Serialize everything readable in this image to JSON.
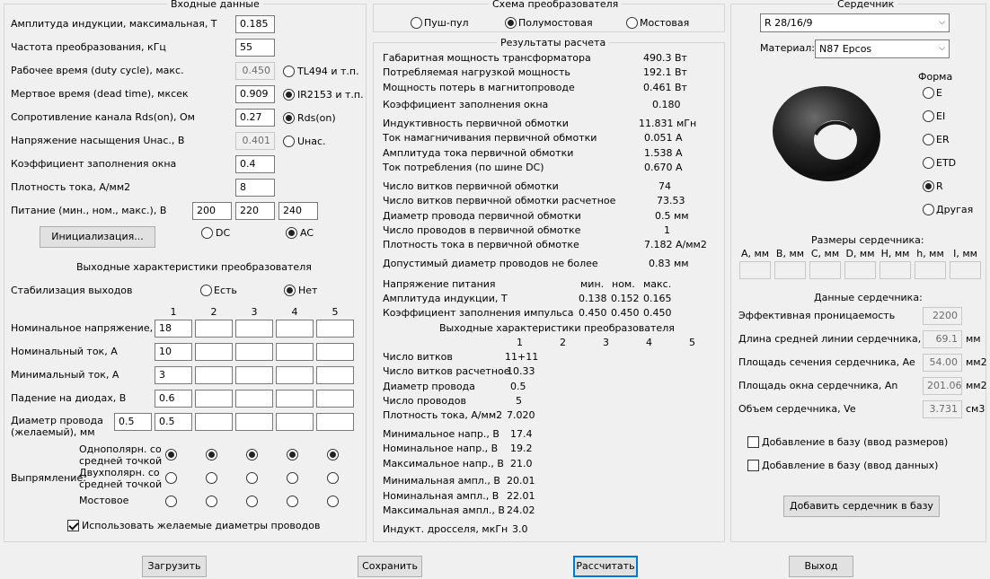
{
  "input": {
    "title": "Входные данные",
    "rows": [
      {
        "label": "Амплитуда индукции, максимальная, Т",
        "value": "0.185"
      },
      {
        "label": "Частота преобразования, кГц",
        "value": "55"
      },
      {
        "label": "Рабочее время (duty cycle), макс.",
        "value": "0.450"
      },
      {
        "label": "Мертвое время (dead time), мксек",
        "value": "0.909"
      },
      {
        "label": "Сопротивление канала Rds(on), Ом",
        "value": "0.27"
      },
      {
        "label": "Напряжение насыщения Uнас., В",
        "value": "0.401"
      },
      {
        "label": "Коэффициент заполнения окна",
        "value": "0.4"
      },
      {
        "label": "Плотность тока, А/мм2",
        "value": "8"
      },
      {
        "label": "Питание (мин., ном., макс.), В",
        "value": ""
      }
    ],
    "supply": [
      "200",
      "220",
      "240"
    ],
    "side_radios": [
      "TL494 и т.п.",
      "IR2153 и т.п.",
      "Rds(on)",
      "Uнас."
    ],
    "init_button": "Инициализация...",
    "dc": "DC",
    "ac": "AC"
  },
  "out": {
    "title": "Выходные характеристики преобразователя",
    "stab_label": "Стабилизация выходов",
    "stab_yes": "Есть",
    "stab_no": "Нет",
    "cols": [
      "1",
      "2",
      "3",
      "4",
      "5"
    ],
    "rows": [
      {
        "label": "Номинальное напряжение, В",
        "v1": "18"
      },
      {
        "label": "Номинальный ток, А",
        "v1": "10"
      },
      {
        "label": "Минимальный ток, А",
        "v1": "3"
      },
      {
        "label": "Падение на диодах, В",
        "v1": "0.6"
      }
    ],
    "wire_label1": "Диаметр провода",
    "wire_label2": "(желаемый), мм",
    "wire_value": "0.5",
    "wire_v1": "0.5",
    "rect_label": "Выпрямление:",
    "rect_opt1a": "Однополярн. со",
    "rect_opt1b": "средней точкой",
    "rect_opt2a": "Двухполярн. со",
    "rect_opt2b": "средней точкой",
    "rect_opt3": "Мостовое",
    "use_wire": "Использовать желаемые диаметры проводов"
  },
  "scheme": {
    "title": "Схема преобразователя",
    "opts": [
      "Пуш-пул",
      "Полумостовая",
      "Мостовая"
    ]
  },
  "results": {
    "title": "Результаты расчета",
    "rows": [
      {
        "label": "Габаритная мощность трансформатора",
        "value": "490.3 Вт"
      },
      {
        "label": "Потребляемая нагрузкой мощность",
        "value": "192.1 Вт"
      },
      {
        "label": "Мощность потерь в магнитопроводе",
        "value": "0.461 Вт"
      },
      {
        "label": "Коэффициент заполнения окна",
        "value": "0.180"
      },
      {
        "label": "Индуктивность первичной обмотки",
        "value": "11.831 мГн"
      },
      {
        "label": "Ток намагничивания первичной обмотки",
        "value": "0.051 А"
      },
      {
        "label": "Амплитуда тока первичной обмотки",
        "value": "1.538 А"
      },
      {
        "label": "Ток потребления (по шине DC)",
        "value": "0.670 А"
      },
      {
        "label": "Число витков первичной обмотки",
        "value": "74"
      },
      {
        "label": "Число витков первичной обмотки расчетное",
        "value": "73.53"
      },
      {
        "label": "Диаметр провода первичной обмотки",
        "value": "0.5 мм"
      },
      {
        "label": "Число проводов в первичной обмотке",
        "value": "1"
      },
      {
        "label": "Плотность тока в первичной обмотке",
        "value": "7.182 А/мм2"
      },
      {
        "label": "Допустимый диаметр проводов не более",
        "value": "0.83 мм"
      }
    ],
    "supply_hdr": "Напряжение питания",
    "min": "мин.",
    "nom": "ном.",
    "max": "макс.",
    "ind_label": "Амплитуда индукции, Т",
    "ind_vals": [
      "0.138",
      "0.152",
      "0.165"
    ],
    "duty_label": "Коэффициент заполнения импульса",
    "duty_vals": [
      "0.450",
      "0.450",
      "0.450"
    ],
    "out_title": "Выходные характеристики преобразователя",
    "cols": [
      "1",
      "2",
      "3",
      "4",
      "5"
    ],
    "out_rows": [
      {
        "label": "Число витков",
        "value": "11+11"
      },
      {
        "label": "Число витков расчетное",
        "value": "10.33"
      },
      {
        "label": "Диаметр провода",
        "value": "0.5"
      },
      {
        "label": "Число проводов",
        "value": "5"
      },
      {
        "label": "Плотность тока, А/мм2",
        "value": "7.020"
      },
      {
        "label": "Минимальное напр., В",
        "value": "17.4"
      },
      {
        "label": "Номинальное напр., В",
        "value": "19.2"
      },
      {
        "label": "Максимальное напр., В",
        "value": "21.0"
      },
      {
        "label": "Минимальная ампл., В",
        "value": "20.01"
      },
      {
        "label": "Номинальная ампл., В",
        "value": "22.01"
      },
      {
        "label": "Максимальная ампл., В",
        "value": "24.02"
      },
      {
        "label": "Индукт. дросселя, мкГн",
        "value": "3.0"
      }
    ]
  },
  "core": {
    "title": "Сердечник",
    "model": "R 28/16/9",
    "material_label": "Материал:",
    "material": "N87 Epcos",
    "shape_label": "Форма",
    "shapes": [
      "E",
      "EI",
      "ER",
      "ETD",
      "R",
      "Другая"
    ],
    "dims_title": "Размеры сердечника:",
    "dims": [
      "A, мм",
      "B, мм",
      "C, мм",
      "D, мм",
      "H, мм",
      "h, мм",
      "I, мм"
    ],
    "data_title": "Данные сердечника:",
    "data": [
      {
        "label": "Эффективная проницаемость",
        "value": "2200",
        "unit": ""
      },
      {
        "label": "Длина средней линии сердечника, le",
        "value": "69.1",
        "unit": "мм"
      },
      {
        "label": "Площадь сечения сердечника, Ae",
        "value": "54.00",
        "unit": "мм2"
      },
      {
        "label": "Площадь окна сердечника, An",
        "value": "201.06",
        "unit": "мм2"
      },
      {
        "label": "Объем сердечника, Ve",
        "value": "3.731",
        "unit": "см3"
      }
    ],
    "add_dims": "Добавление в базу (ввод размеров)",
    "add_data": "Добавление в базу (ввод данных)",
    "add_button": "Добавить сердечник в базу"
  },
  "bottom": {
    "load": "Загрузить",
    "save": "Сохранить",
    "calc": "Рассчитать",
    "exit": "Выход"
  }
}
